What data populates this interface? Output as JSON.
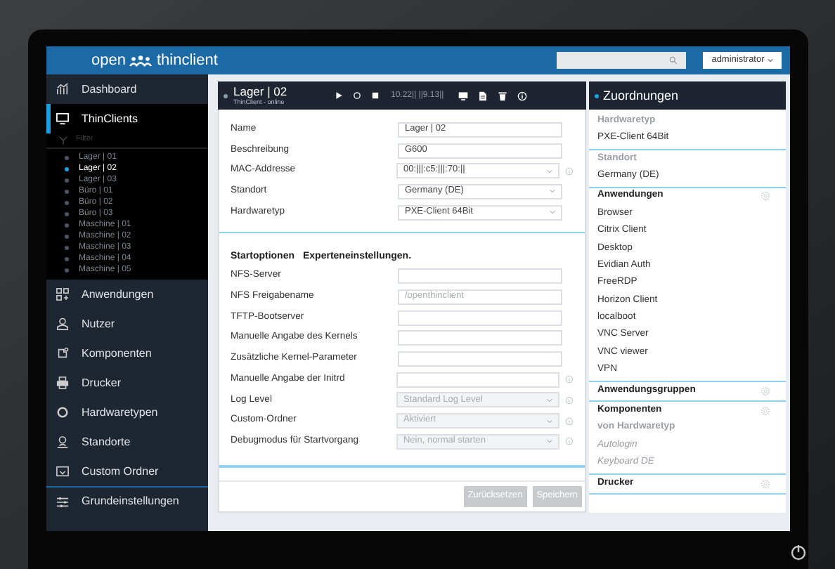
{
  "header": {
    "logo_left": "open",
    "logo_right": "thinclient",
    "user_menu": "administrator"
  },
  "sidebar": {
    "items": [
      {
        "label": "Dashboard",
        "selected": false
      },
      {
        "label": "ThinClients",
        "selected": true,
        "filter_placeholder": "Filter",
        "clients": [
          {
            "label": "Lager | 01",
            "selected": false
          },
          {
            "label": "Lager | 02",
            "selected": true
          },
          {
            "label": "Lager | 03",
            "selected": false
          },
          {
            "label": "Büro | 01",
            "selected": false
          },
          {
            "label": "Büro | 02",
            "selected": false
          },
          {
            "label": "Büro | 03",
            "selected": false
          },
          {
            "label": "Maschine | 01",
            "selected": false
          },
          {
            "label": "Maschine | 02",
            "selected": false
          },
          {
            "label": "Maschine | 03",
            "selected": false
          },
          {
            "label": "Maschine | 04",
            "selected": false
          },
          {
            "label": "Maschine | 05",
            "selected": false
          }
        ]
      },
      {
        "label": "Anwendungen",
        "selected": false
      },
      {
        "label": "Nutzer",
        "selected": false
      },
      {
        "label": "Komponenten",
        "selected": false
      },
      {
        "label": "Drucker",
        "selected": false
      },
      {
        "label": "Hardwaretypen",
        "selected": false
      },
      {
        "label": "Standorte",
        "selected": false
      },
      {
        "label": "Custom Ordner",
        "selected": false
      },
      {
        "label": "Grundeinstellungen",
        "selected": false
      }
    ]
  },
  "client": {
    "name": "Lager | 02",
    "status": "ThinClient - online",
    "ip": "10.22|| ||9.13||",
    "general_fields": [
      {
        "label": "Name",
        "kind": "text",
        "value": "Lager | 02",
        "info": false,
        "disabled": false
      },
      {
        "label": "Beschreibung",
        "kind": "text",
        "value": "G600",
        "info": false,
        "disabled": false
      },
      {
        "label": "MAC-Addresse",
        "kind": "select",
        "value": "00:|||:c5:|||:70:||",
        "info": true,
        "disabled": false
      },
      {
        "label": "Standort",
        "kind": "select",
        "value": "Germany (DE)",
        "info": false,
        "disabled": false
      },
      {
        "label": "Hardwaretyp",
        "kind": "select",
        "value": "PXE-Client 64Bit",
        "info": false,
        "disabled": false
      }
    ],
    "start_options": {
      "title": "Startoptionen",
      "subtitle": "Experteneinstellungen.",
      "fields": [
        {
          "label": "NFS-Server",
          "kind": "text",
          "info": false,
          "disabled": false
        },
        {
          "label": "NFS Freigabename",
          "kind": "text",
          "placeholder": "/openthinclient",
          "info": false,
          "disabled": false
        },
        {
          "label": "TFTP-Bootserver",
          "kind": "text",
          "info": false,
          "disabled": false
        },
        {
          "label": "Manuelle Angabe des Kernels",
          "kind": "text",
          "info": false,
          "disabled": false
        },
        {
          "label": "Zusätzliche Kernel-Parameter",
          "kind": "text",
          "info": false,
          "disabled": false
        },
        {
          "label": "Manuelle Angabe der Initrd",
          "kind": "text",
          "info": true,
          "disabled": false
        },
        {
          "label": "Log Level",
          "kind": "select",
          "value": "Standard Log Level",
          "info": true,
          "disabled": true
        },
        {
          "label": "Custom-Ordner",
          "kind": "select",
          "value": "Aktiviert",
          "info": true,
          "disabled": true
        },
        {
          "label": "Debugmodus für Startvorgang",
          "kind": "select",
          "value": "Nein, normal starten",
          "info": true,
          "disabled": true
        }
      ]
    },
    "buttons": [
      {
        "label": "Zurücksetzen",
        "disabled": true
      },
      {
        "label": "Speichern",
        "disabled": true
      }
    ]
  },
  "assignments": {
    "title": "Zuordnungen",
    "sections": [
      {
        "title": "Hardwaretyp",
        "kind": "heading",
        "items": [
          {
            "label": "PXE-Client 64Bit",
            "kind": "item"
          }
        ]
      },
      {
        "title": "Standort",
        "kind": "heading",
        "items": [
          {
            "label": "Germany (DE)",
            "kind": "item"
          }
        ]
      },
      {
        "title": "Anwendungen",
        "kind": "group",
        "items": [
          {
            "label": "Browser",
            "kind": "item"
          },
          {
            "label": "Citrix Client",
            "kind": "item"
          },
          {
            "label": "Desktop",
            "kind": "item"
          },
          {
            "label": "Evidian Auth",
            "kind": "item"
          },
          {
            "label": "FreeRDP",
            "kind": "item"
          },
          {
            "label": "Horizon Client",
            "kind": "item"
          },
          {
            "label": "localboot",
            "kind": "item"
          },
          {
            "label": "VNC Server",
            "kind": "item"
          },
          {
            "label": "VNC viewer",
            "kind": "item"
          },
          {
            "label": "VPN",
            "kind": "item"
          }
        ]
      },
      {
        "title": "Anwendungsgruppen",
        "kind": "group"
      },
      {
        "title": "Komponenten",
        "kind": "group",
        "items": [
          {
            "label": "von Hardwaretyp",
            "kind": "subheading"
          },
          {
            "label": "Autologin",
            "kind": "inherited"
          },
          {
            "label": "Keyboard DE",
            "kind": "inherited"
          }
        ]
      },
      {
        "title": "Drucker",
        "kind": "group"
      }
    ]
  }
}
